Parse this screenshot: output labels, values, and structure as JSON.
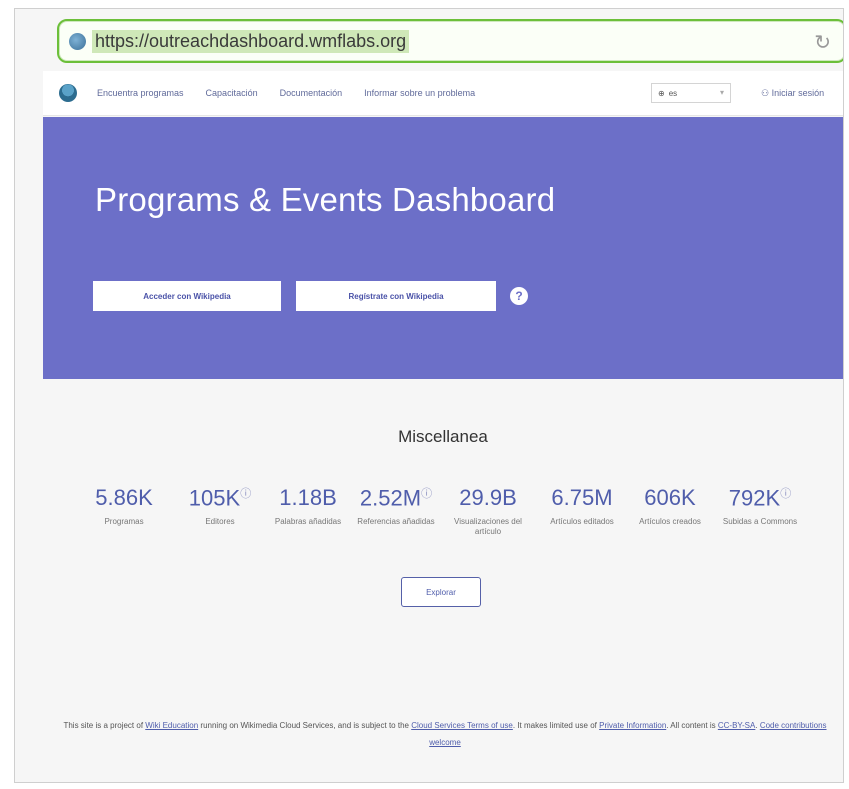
{
  "browser": {
    "url": "https://outreachdashboard.wmflabs.org"
  },
  "nav": {
    "links": [
      "Encuentra programas",
      "Capacitación",
      "Documentación",
      "Informar sobre un problema"
    ],
    "language": "es",
    "login": "Iniciar sesión"
  },
  "hero": {
    "title": "Programs & Events Dashboard",
    "login_button": "Acceder con Wikipedia",
    "signup_button": "Regístrate con Wikipedia",
    "help_glyph": "?"
  },
  "stats": {
    "title": "Miscellanea",
    "items": [
      {
        "value": "5.86K",
        "label": "Programas"
      },
      {
        "value": "105K",
        "label": "Editores"
      },
      {
        "value": "1.18B",
        "label": "Palabras añadidas"
      },
      {
        "value": "2.52M",
        "label": "Referencias añadidas"
      },
      {
        "value": "29.9B",
        "label": "Visualizaciones del artículo"
      },
      {
        "value": "6.75M",
        "label": "Artículos editados"
      },
      {
        "value": "606K",
        "label": "Artículos creados"
      },
      {
        "value": "792K",
        "label": "Subidas a Commons"
      }
    ],
    "explore_button": "Explorar"
  },
  "footer": {
    "t1": "This site is a project of ",
    "link1": "Wiki Education",
    "t2": " running on Wikimedia Cloud Services, and is subject to the ",
    "link2": "Cloud Services Terms of use",
    "t3": ". It makes limited use of ",
    "link3": "Private Information",
    "t4": ". All content is ",
    "link4": "CC-BY-SA",
    "t5": ". ",
    "link5": "Code contributions welcome"
  },
  "colors": {
    "hero_bg": "#6c6fc8",
    "accent": "#4f5dab",
    "url_border": "#6cbf3a"
  }
}
